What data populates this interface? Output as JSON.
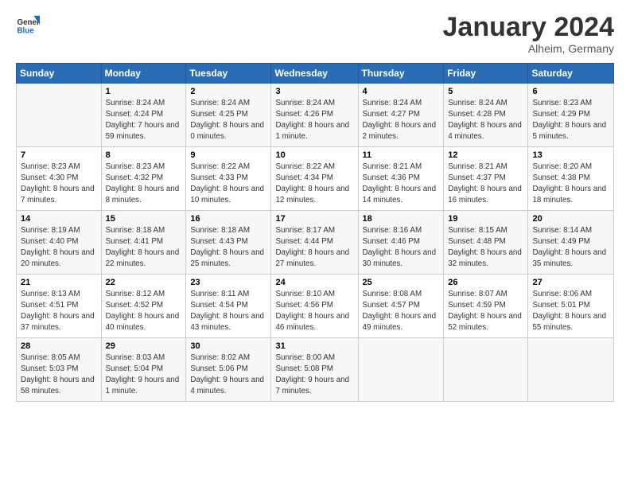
{
  "logo": {
    "line1": "General",
    "line2": "Blue"
  },
  "title": "January 2024",
  "location": "Alheim, Germany",
  "days_header": [
    "Sunday",
    "Monday",
    "Tuesday",
    "Wednesday",
    "Thursday",
    "Friday",
    "Saturday"
  ],
  "weeks": [
    [
      {
        "day": "",
        "sunrise": "",
        "sunset": "",
        "daylight": ""
      },
      {
        "day": "1",
        "sunrise": "Sunrise: 8:24 AM",
        "sunset": "Sunset: 4:24 PM",
        "daylight": "Daylight: 7 hours and 59 minutes."
      },
      {
        "day": "2",
        "sunrise": "Sunrise: 8:24 AM",
        "sunset": "Sunset: 4:25 PM",
        "daylight": "Daylight: 8 hours and 0 minutes."
      },
      {
        "day": "3",
        "sunrise": "Sunrise: 8:24 AM",
        "sunset": "Sunset: 4:26 PM",
        "daylight": "Daylight: 8 hours and 1 minute."
      },
      {
        "day": "4",
        "sunrise": "Sunrise: 8:24 AM",
        "sunset": "Sunset: 4:27 PM",
        "daylight": "Daylight: 8 hours and 2 minutes."
      },
      {
        "day": "5",
        "sunrise": "Sunrise: 8:24 AM",
        "sunset": "Sunset: 4:28 PM",
        "daylight": "Daylight: 8 hours and 4 minutes."
      },
      {
        "day": "6",
        "sunrise": "Sunrise: 8:23 AM",
        "sunset": "Sunset: 4:29 PM",
        "daylight": "Daylight: 8 hours and 5 minutes."
      }
    ],
    [
      {
        "day": "7",
        "sunrise": "Sunrise: 8:23 AM",
        "sunset": "Sunset: 4:30 PM",
        "daylight": "Daylight: 8 hours and 7 minutes."
      },
      {
        "day": "8",
        "sunrise": "Sunrise: 8:23 AM",
        "sunset": "Sunset: 4:32 PM",
        "daylight": "Daylight: 8 hours and 8 minutes."
      },
      {
        "day": "9",
        "sunrise": "Sunrise: 8:22 AM",
        "sunset": "Sunset: 4:33 PM",
        "daylight": "Daylight: 8 hours and 10 minutes."
      },
      {
        "day": "10",
        "sunrise": "Sunrise: 8:22 AM",
        "sunset": "Sunset: 4:34 PM",
        "daylight": "Daylight: 8 hours and 12 minutes."
      },
      {
        "day": "11",
        "sunrise": "Sunrise: 8:21 AM",
        "sunset": "Sunset: 4:36 PM",
        "daylight": "Daylight: 8 hours and 14 minutes."
      },
      {
        "day": "12",
        "sunrise": "Sunrise: 8:21 AM",
        "sunset": "Sunset: 4:37 PM",
        "daylight": "Daylight: 8 hours and 16 minutes."
      },
      {
        "day": "13",
        "sunrise": "Sunrise: 8:20 AM",
        "sunset": "Sunset: 4:38 PM",
        "daylight": "Daylight: 8 hours and 18 minutes."
      }
    ],
    [
      {
        "day": "14",
        "sunrise": "Sunrise: 8:19 AM",
        "sunset": "Sunset: 4:40 PM",
        "daylight": "Daylight: 8 hours and 20 minutes."
      },
      {
        "day": "15",
        "sunrise": "Sunrise: 8:18 AM",
        "sunset": "Sunset: 4:41 PM",
        "daylight": "Daylight: 8 hours and 22 minutes."
      },
      {
        "day": "16",
        "sunrise": "Sunrise: 8:18 AM",
        "sunset": "Sunset: 4:43 PM",
        "daylight": "Daylight: 8 hours and 25 minutes."
      },
      {
        "day": "17",
        "sunrise": "Sunrise: 8:17 AM",
        "sunset": "Sunset: 4:44 PM",
        "daylight": "Daylight: 8 hours and 27 minutes."
      },
      {
        "day": "18",
        "sunrise": "Sunrise: 8:16 AM",
        "sunset": "Sunset: 4:46 PM",
        "daylight": "Daylight: 8 hours and 30 minutes."
      },
      {
        "day": "19",
        "sunrise": "Sunrise: 8:15 AM",
        "sunset": "Sunset: 4:48 PM",
        "daylight": "Daylight: 8 hours and 32 minutes."
      },
      {
        "day": "20",
        "sunrise": "Sunrise: 8:14 AM",
        "sunset": "Sunset: 4:49 PM",
        "daylight": "Daylight: 8 hours and 35 minutes."
      }
    ],
    [
      {
        "day": "21",
        "sunrise": "Sunrise: 8:13 AM",
        "sunset": "Sunset: 4:51 PM",
        "daylight": "Daylight: 8 hours and 37 minutes."
      },
      {
        "day": "22",
        "sunrise": "Sunrise: 8:12 AM",
        "sunset": "Sunset: 4:52 PM",
        "daylight": "Daylight: 8 hours and 40 minutes."
      },
      {
        "day": "23",
        "sunrise": "Sunrise: 8:11 AM",
        "sunset": "Sunset: 4:54 PM",
        "daylight": "Daylight: 8 hours and 43 minutes."
      },
      {
        "day": "24",
        "sunrise": "Sunrise: 8:10 AM",
        "sunset": "Sunset: 4:56 PM",
        "daylight": "Daylight: 8 hours and 46 minutes."
      },
      {
        "day": "25",
        "sunrise": "Sunrise: 8:08 AM",
        "sunset": "Sunset: 4:57 PM",
        "daylight": "Daylight: 8 hours and 49 minutes."
      },
      {
        "day": "26",
        "sunrise": "Sunrise: 8:07 AM",
        "sunset": "Sunset: 4:59 PM",
        "daylight": "Daylight: 8 hours and 52 minutes."
      },
      {
        "day": "27",
        "sunrise": "Sunrise: 8:06 AM",
        "sunset": "Sunset: 5:01 PM",
        "daylight": "Daylight: 8 hours and 55 minutes."
      }
    ],
    [
      {
        "day": "28",
        "sunrise": "Sunrise: 8:05 AM",
        "sunset": "Sunset: 5:03 PM",
        "daylight": "Daylight: 8 hours and 58 minutes."
      },
      {
        "day": "29",
        "sunrise": "Sunrise: 8:03 AM",
        "sunset": "Sunset: 5:04 PM",
        "daylight": "Daylight: 9 hours and 1 minute."
      },
      {
        "day": "30",
        "sunrise": "Sunrise: 8:02 AM",
        "sunset": "Sunset: 5:06 PM",
        "daylight": "Daylight: 9 hours and 4 minutes."
      },
      {
        "day": "31",
        "sunrise": "Sunrise: 8:00 AM",
        "sunset": "Sunset: 5:08 PM",
        "daylight": "Daylight: 9 hours and 7 minutes."
      },
      {
        "day": "",
        "sunrise": "",
        "sunset": "",
        "daylight": ""
      },
      {
        "day": "",
        "sunrise": "",
        "sunset": "",
        "daylight": ""
      },
      {
        "day": "",
        "sunrise": "",
        "sunset": "",
        "daylight": ""
      }
    ]
  ]
}
